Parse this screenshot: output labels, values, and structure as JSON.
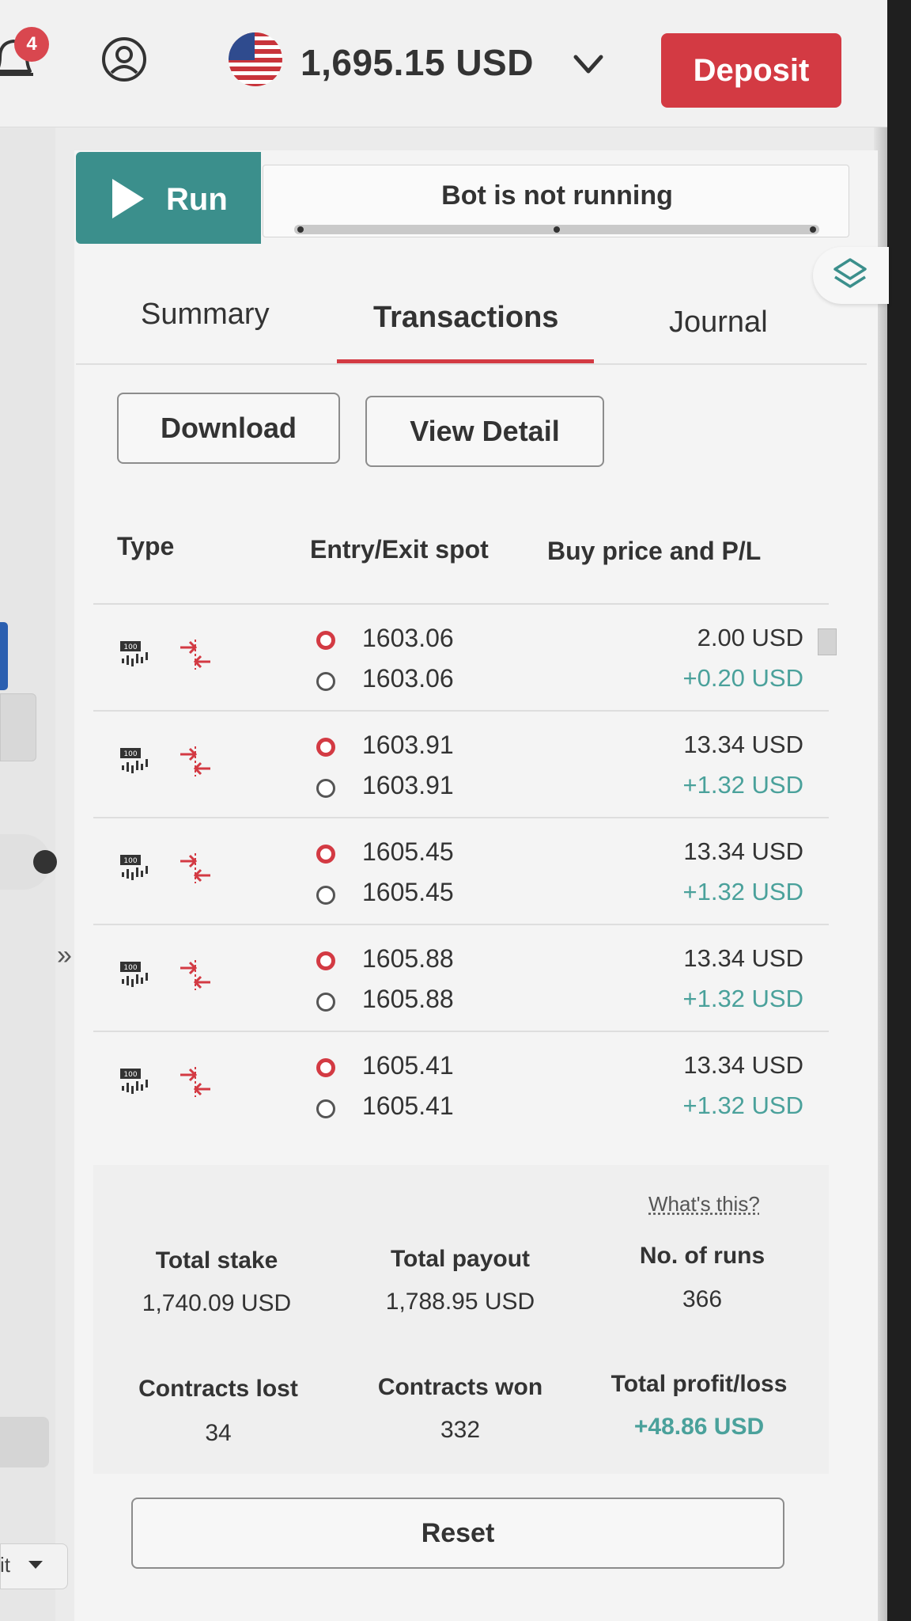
{
  "header": {
    "notification_count": "4",
    "balance": "1,695.15 USD",
    "deposit_label": "Deposit"
  },
  "left_panel": {
    "select_label": "it"
  },
  "bot": {
    "run_label": "Run",
    "status": "Bot is not running"
  },
  "tabs": [
    {
      "label": "Summary",
      "active": false
    },
    {
      "label": "Transactions",
      "active": true
    },
    {
      "label": "Journal",
      "active": false
    }
  ],
  "actions": {
    "download_label": "Download",
    "view_detail_label": "View Detail"
  },
  "table": {
    "columns": [
      "Type",
      "Entry/Exit spot",
      "Buy price and P/L"
    ],
    "rows": [
      {
        "entry": "1603.06",
        "exit": "1603.06",
        "buy_price": "2.00 USD",
        "pl": "+0.20 USD"
      },
      {
        "entry": "1603.91",
        "exit": "1603.91",
        "buy_price": "13.34 USD",
        "pl": "+1.32 USD"
      },
      {
        "entry": "1605.45",
        "exit": "1605.45",
        "buy_price": "13.34 USD",
        "pl": "+1.32 USD"
      },
      {
        "entry": "1605.88",
        "exit": "1605.88",
        "buy_price": "13.34 USD",
        "pl": "+1.32 USD"
      },
      {
        "entry": "1605.41",
        "exit": "1605.41",
        "buy_price": "13.34 USD",
        "pl": "+1.32 USD"
      }
    ],
    "type_icon_text": "100"
  },
  "summary": {
    "whats_this": "What's this?",
    "total_stake_label": "Total stake",
    "total_stake": "1,740.09 USD",
    "total_payout_label": "Total payout",
    "total_payout": "1,788.95 USD",
    "runs_label": "No. of runs",
    "runs": "366",
    "lost_label": "Contracts lost",
    "lost": "34",
    "won_label": "Contracts won",
    "won": "332",
    "pl_label": "Total profit/loss",
    "pl": "+48.86 USD"
  },
  "reset_label": "Reset",
  "colors": {
    "accent_red": "#d33a43",
    "run_teal": "#3b8f8c",
    "profit_green": "#4aa19b"
  },
  "icons": {
    "notifications": "bell-icon",
    "account": "account-icon",
    "currency": "us-flag-icon",
    "balance_menu": "chevron-down-icon",
    "run": "play-icon",
    "quick_strategy": "layers-icon",
    "contract_type": "volatility-100-index-icon",
    "direction": "rise-fall-arrows-icon"
  }
}
